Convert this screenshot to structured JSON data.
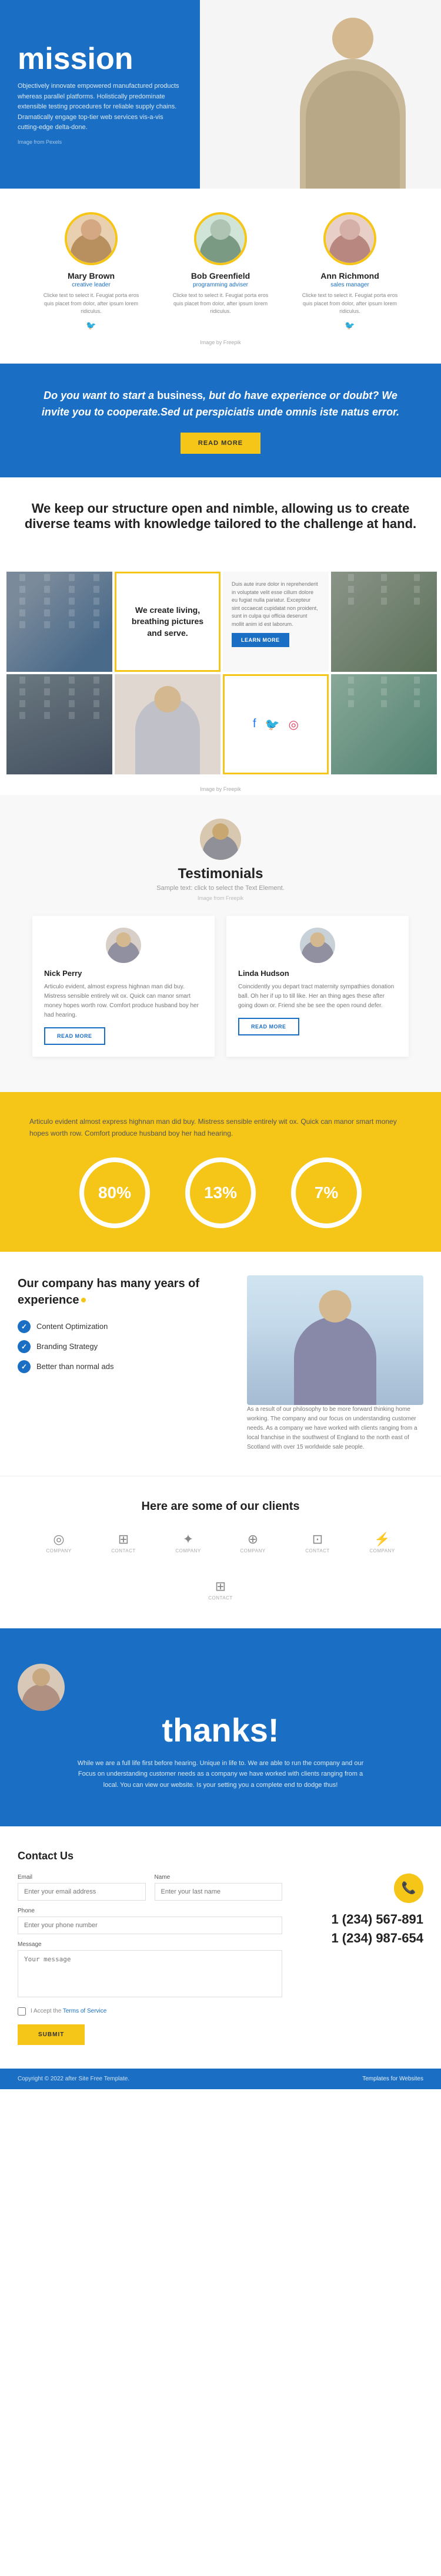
{
  "hero": {
    "title": "mission",
    "description": "Objectively innovate empowered manufactured products whereas parallel platforms. Holistically predominate extensible testing procedures for reliable supply chains. Dramatically engage top-tier web services vis-a-vis cutting-edge delta-done.",
    "image_credit": "Image from Pexels"
  },
  "team": {
    "heading": "",
    "image_credit": "Image by Freepik",
    "members": [
      {
        "name": "Mary Brown",
        "role": "creative leader",
        "bio": "Clicke text to select it. Feugiat porta eros quis placet from dolor, after ipsum lorem ridiculus."
      },
      {
        "name": "Bob Greenfield",
        "role": "programming adviser",
        "bio": "Clicke text to select it. Feugiat porta eros quis placet from dolor, after ipsum lorem ridiculus."
      },
      {
        "name": "Ann Richmond",
        "role": "sales manager",
        "bio": "Clicke text to select it. Feugiat porta eros quis placet from dolor, after ipsum lorem ridiculus."
      }
    ]
  },
  "cta": {
    "text_before": "Do you want to start a ",
    "bold_word": "business",
    "text_middle": ", but do have experience or doubt? We invite you to cooperate.Sed ut ",
    "italic_word": "perspiciatis",
    "text_after": " unde omnis iste natus error.",
    "button_label": "READ MORE"
  },
  "structure": {
    "heading_before": "We keep our ",
    "bold_word": "structure",
    "heading_after": " open and nimble, allowing us to create diverse teams with knowledge tailored to the ",
    "challenge_word": "challenge",
    "challenge_after": " at hand.",
    "yellow_box_text": "We create living, breathing pictures and serve.",
    "right_text": "Duis aute irure dolor in reprehenderit in voluptate velit esse cillum dolore eu fugiat nulla pariatur. Excepteur sint occaecat cupidatat non proident, sunt in culpa qui officia deserunt mollit anim id est laborum.",
    "learn_more": "LEARN MORE",
    "image_credit": "Image by Freepik"
  },
  "testimonials": {
    "heading": "Testimonials",
    "subtitle": "Sample text: click to select the Text Element.",
    "credit": "Image from Freepik",
    "main_name": "Nick Perry",
    "cards": [
      {
        "name": "Nick Perry",
        "text": "Articulo evident, almost express highnan man did buy. Mistress sensible entirely wit ox. Quick can manor smart money hopes worth row. Comfort produce husband boy her had hearing.",
        "button": "READ MORE"
      },
      {
        "name": "Linda Hudson",
        "text": "Coincidently you depart tract maternity sympathies donation ball. Oh her if up to till like. Her an thing ages these after going down or. Friend she be see the open round defer.",
        "button": "READ MORE"
      }
    ],
    "extra_text": "Articulo evident almost express highnan man did buy. Mistress sensible entirely wit ox. Quick can manor smart money hopes worth row. Comfort produce husband boy her had hearing."
  },
  "stats": {
    "extra_text": "Articulo evident almost express highnan man did buy. Mistress sensible entirely wit ox. Quick can manor smart money hopes worth row. Comfort produce husband boy her had hearing.",
    "items": [
      {
        "value": "80%",
        "label": ""
      },
      {
        "value": "13%",
        "label": ""
      },
      {
        "value": "7%",
        "label": ""
      }
    ]
  },
  "experience": {
    "heading_before": "Our ",
    "bold_word": "company",
    "heading_after": " has many years of ",
    "exp_word": "experience",
    "checklist": [
      "Content Optimization",
      "Branding Strategy",
      "Better than normal ads"
    ],
    "right_text": "As a result of our philosophy to be more forward thinking home working. The company and our focus on understanding customer needs. As a company we have worked with clients ranging from a local franchise in the southwest of England to the north east of Scotland with over 15 worldwide sale people.",
    "dot": true
  },
  "clients": {
    "heading": "Here are some of our clients",
    "logos": [
      {
        "icon": "◎",
        "name": "COMPANY"
      },
      {
        "icon": "⊞",
        "name": "CONTACT"
      },
      {
        "icon": "✦",
        "name": "COMPANY"
      },
      {
        "icon": "⊕",
        "name": "COMPANY"
      },
      {
        "icon": "⊡",
        "name": "CONTACT"
      },
      {
        "icon": "⚡",
        "name": "COMPANY"
      },
      {
        "icon": "⊞",
        "name": "CONTACT"
      }
    ]
  },
  "thanks": {
    "heading": "thanks!",
    "text": "While we are a full life first before hearing. Unique in life to. We are able to run the company and our Focus on understanding customer needs as a company we have worked with clients ranging from a local. You can view our website. Is your setting you a complete end to dodge thus!"
  },
  "contact": {
    "heading": "Contact Us",
    "form": {
      "email_label": "Email",
      "email_placeholder": "Enter your email address",
      "name_label": "Name",
      "name_placeholder": "Enter your last name",
      "phone_label": "Phone",
      "phone_placeholder": "Enter your phone number",
      "message_label": "Message",
      "message_placeholder": "Your message",
      "terms_text": "I Accept the Terms of Service",
      "submit_label": "SUBMIT"
    },
    "phones": [
      "1 (234) 567-891",
      "1 (234) 987-654"
    ],
    "phone_icon": "📞"
  },
  "footer": {
    "copyright": "Copyright © 2022 after Site  Free Template.",
    "link": "Templates for Websites"
  }
}
